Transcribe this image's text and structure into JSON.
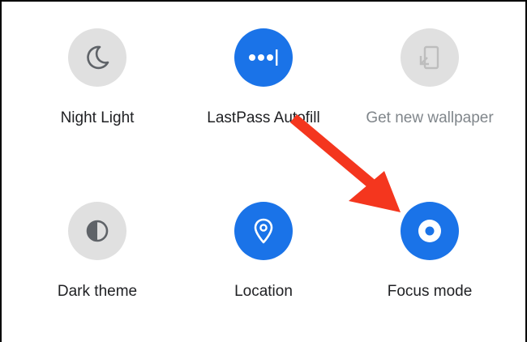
{
  "quick_settings": {
    "tiles": [
      {
        "label": "Night Light",
        "icon": "moon-icon",
        "state": "off"
      },
      {
        "label": "LastPass Autofill",
        "icon": "password-dots-icon",
        "state": "on"
      },
      {
        "label": "Get new wallpaper",
        "icon": "wallpaper-phone-icon",
        "state": "unavailable"
      },
      {
        "label": "Dark theme",
        "icon": "half-circle-icon",
        "state": "off"
      },
      {
        "label": "Location",
        "icon": "location-pin-icon",
        "state": "on"
      },
      {
        "label": "Focus mode",
        "icon": "focus-target-icon",
        "state": "on"
      }
    ]
  },
  "colors": {
    "active": "#1a73e8",
    "inactive": "#e0e0e0",
    "annotation_arrow": "#f4361e"
  }
}
